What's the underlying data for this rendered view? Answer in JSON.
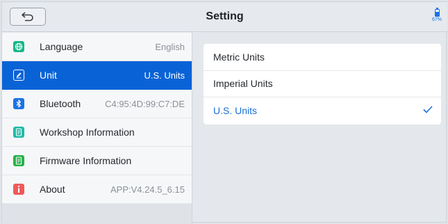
{
  "header": {
    "title": "Setting",
    "battery_text": "67%",
    "battery_level_percent": 67
  },
  "sidebar": {
    "items": [
      {
        "label": "Language",
        "value": "English",
        "icon": "globe-icon",
        "icon_color": "#19b889"
      },
      {
        "label": "Unit",
        "value": "U.S. Units",
        "icon": "pencil-icon",
        "icon_color": "#ffffff",
        "active": true
      },
      {
        "label": "Bluetooth",
        "value": "C4:95:4D:99:C7:DE",
        "icon": "bluetooth-icon",
        "icon_color": "#1a73e8"
      },
      {
        "label": "Workshop Information",
        "value": "",
        "icon": "workshop-doc-icon",
        "icon_color": "#1fbba8"
      },
      {
        "label": "Firmware Information",
        "value": "",
        "icon": "firmware-doc-icon",
        "icon_color": "#26b24a"
      },
      {
        "label": "About",
        "value": "APP:V4.24.5_6.15",
        "icon": "info-icon",
        "icon_color": "#f05a5a"
      }
    ]
  },
  "unit_options": [
    {
      "label": "Metric Units",
      "selected": false
    },
    {
      "label": "Imperial Units",
      "selected": false
    },
    {
      "label": "U.S. Units",
      "selected": true
    }
  ],
  "colors": {
    "accent": "#0a63d6",
    "selected_text": "#1a6fd8"
  }
}
